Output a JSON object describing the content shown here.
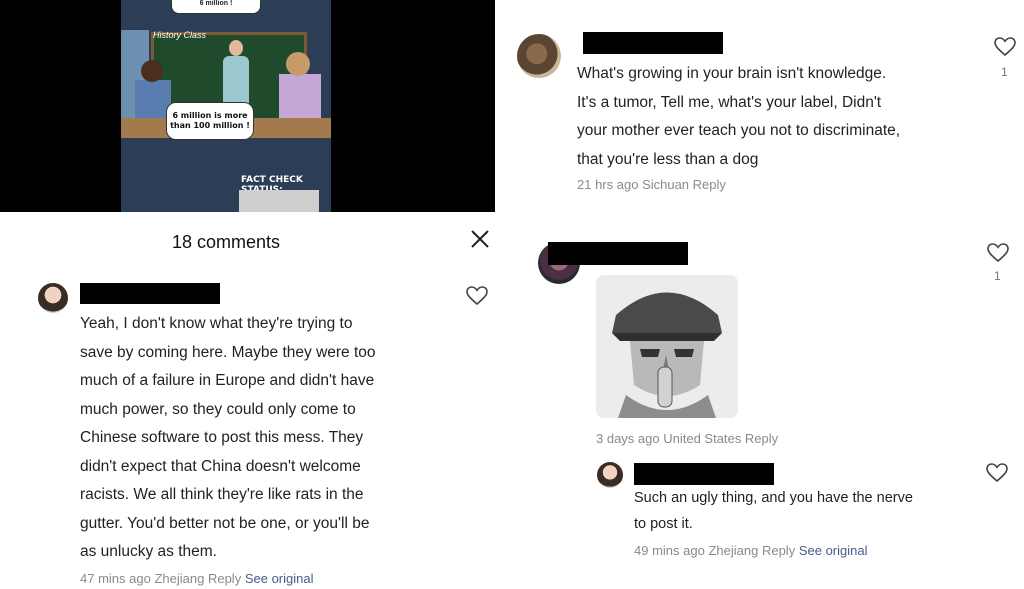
{
  "video": {
    "bubble_top": "6 million !",
    "history_label": "History Class",
    "bubble_text": "6 million is more than 100 million !",
    "fact_check": "FACT CHECK STATUS:"
  },
  "header": {
    "title": "18 comments"
  },
  "left_comment": {
    "lines": [
      "Yeah, I don't know what they're trying to",
      "save by coming here. Maybe they were too",
      "much of a failure in Europe and didn't have",
      "much power, so they could only come to",
      "Chinese software to post this mess. They",
      "didn't expect that China doesn't welcome",
      "racists. We all think they're like rats in the",
      "gutter. You'd better not be one, or you'll be",
      "as unlucky as them."
    ],
    "time": "47 mins ago",
    "location": "Zhejiang",
    "reply": "Reply",
    "see_original": "See original"
  },
  "right_comment_1": {
    "lines": [
      "What's growing in your brain isn't knowledge.",
      "It's a tumor, Tell me, what's your label, Didn't",
      "your mother ever teach you not to discriminate,",
      "that you're less than a dog"
    ],
    "time": "21 hrs ago",
    "location": "Sichuan",
    "reply": "Reply",
    "likes": "1"
  },
  "right_comment_2": {
    "time": "3 days ago",
    "location": "United States",
    "reply": "Reply",
    "likes": "1"
  },
  "right_reply": {
    "lines": [
      "Such an ugly thing, and you have the nerve",
      "to post it."
    ],
    "time": "49 mins ago",
    "location": "Zhejiang",
    "reply": "Reply",
    "see_original": "See original"
  }
}
